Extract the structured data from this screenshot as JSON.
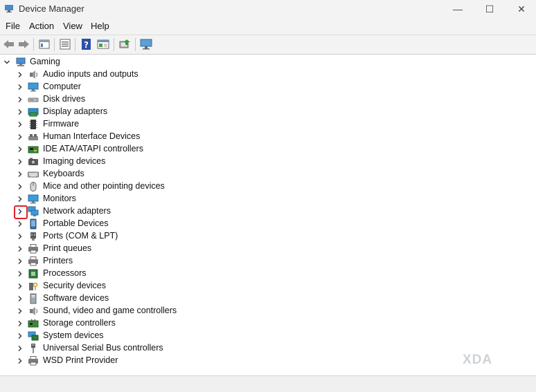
{
  "window": {
    "title": "Device Manager",
    "minimize": "—",
    "maximize": "☐",
    "close": "✕"
  },
  "menu": [
    {
      "label": "File"
    },
    {
      "label": "Action"
    },
    {
      "label": "View"
    },
    {
      "label": "Help"
    }
  ],
  "toolbar": {
    "buttons": [
      "back-icon",
      "forward-icon",
      "properties-pane-icon",
      "view-icon",
      "help-icon",
      "show-hide-icon",
      "update-driver-icon",
      "scan-hardware-icon"
    ]
  },
  "tree": {
    "root": {
      "label": "Gaming",
      "icon": "computer-icon"
    },
    "categories": [
      {
        "label": "Audio inputs and outputs",
        "icon": "speaker-icon"
      },
      {
        "label": "Computer",
        "icon": "monitor-icon"
      },
      {
        "label": "Disk drives",
        "icon": "disk-drive-icon"
      },
      {
        "label": "Display adapters",
        "icon": "display-adapter-icon"
      },
      {
        "label": "Firmware",
        "icon": "firmware-icon"
      },
      {
        "label": "Human Interface Devices",
        "icon": "hid-icon"
      },
      {
        "label": "IDE ATA/ATAPI controllers",
        "icon": "ide-controller-icon"
      },
      {
        "label": "Imaging devices",
        "icon": "camera-icon"
      },
      {
        "label": "Keyboards",
        "icon": "keyboard-icon"
      },
      {
        "label": "Mice and other pointing devices",
        "icon": "mouse-icon"
      },
      {
        "label": "Monitors",
        "icon": "monitor-icon"
      },
      {
        "label": "Network adapters",
        "icon": "network-adapter-icon"
      },
      {
        "label": "Portable Devices",
        "icon": "portable-device-icon"
      },
      {
        "label": "Ports (COM & LPT)",
        "icon": "port-icon"
      },
      {
        "label": "Print queues",
        "icon": "printer-icon"
      },
      {
        "label": "Printers",
        "icon": "printer-icon"
      },
      {
        "label": "Processors",
        "icon": "processor-icon"
      },
      {
        "label": "Security devices",
        "icon": "security-device-icon"
      },
      {
        "label": "Software devices",
        "icon": "software-device-icon"
      },
      {
        "label": "Sound, video and game controllers",
        "icon": "speaker-icon"
      },
      {
        "label": "Storage controllers",
        "icon": "storage-controller-icon"
      },
      {
        "label": "System devices",
        "icon": "system-device-icon"
      },
      {
        "label": "Universal Serial Bus controllers",
        "icon": "usb-icon"
      },
      {
        "label": "WSD Print Provider",
        "icon": "printer-icon"
      }
    ],
    "highlighted_index": 11,
    "highlight_color": "#e0202a"
  },
  "watermark": "XDA"
}
